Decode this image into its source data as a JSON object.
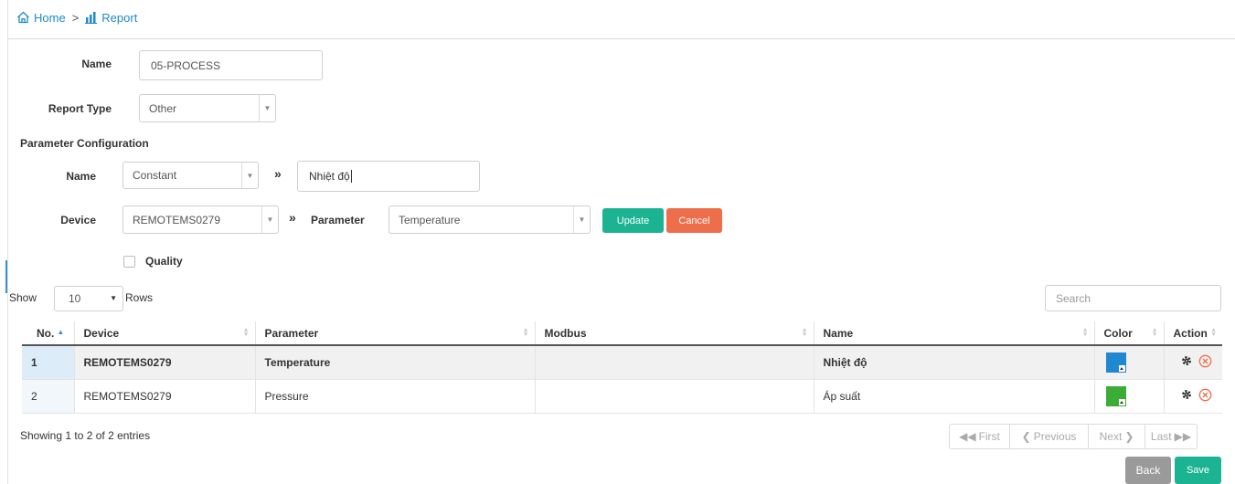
{
  "breadcrumb": {
    "home": "Home",
    "separator": ">",
    "report": "Report"
  },
  "form": {
    "name_label": "Name",
    "name_value": "05-PROCESS",
    "report_type_label": "Report Type",
    "report_type_value": "Other"
  },
  "param_config": {
    "title": "Parameter Configuration",
    "name_label": "Name",
    "name_type_value": "Constant",
    "name_text_value": "Nhiệt độ",
    "device_label": "Device",
    "device_value": "REMOTEMS0279",
    "parameter_label": "Parameter",
    "parameter_value": "Temperature",
    "arrow_glyph": "»",
    "update_label": "Update",
    "cancel_label": "Cancel",
    "quality_label": "Quality",
    "quality_checked": false
  },
  "table_controls": {
    "show_label": "Show",
    "rows_value": "10",
    "rows_label": "Rows",
    "search_placeholder": "Search"
  },
  "table": {
    "columns": [
      "No.",
      "Device",
      "Parameter",
      "Modbus",
      "Name",
      "Color",
      "Action"
    ],
    "rows": [
      {
        "no": "1",
        "device": "REMOTEMS0279",
        "parameter": "Temperature",
        "modbus": "",
        "name": "Nhiệt độ",
        "color": "#1e88d0",
        "selected": true
      },
      {
        "no": "2",
        "device": "REMOTEMS0279",
        "parameter": "Pressure",
        "modbus": "",
        "name": "Áp suất",
        "color": "#3bac35",
        "selected": false
      }
    ]
  },
  "footer": {
    "info": "Showing 1 to 2 of 2 entries",
    "first": "First",
    "previous": "Previous",
    "next": "Next",
    "last": "Last",
    "back_label": "Back",
    "save_label": "Save"
  },
  "colors": {
    "accent": "#1e8ac7",
    "update": "#1bb392",
    "cancel": "#ee6e4b",
    "back": "#9a9a9a"
  }
}
